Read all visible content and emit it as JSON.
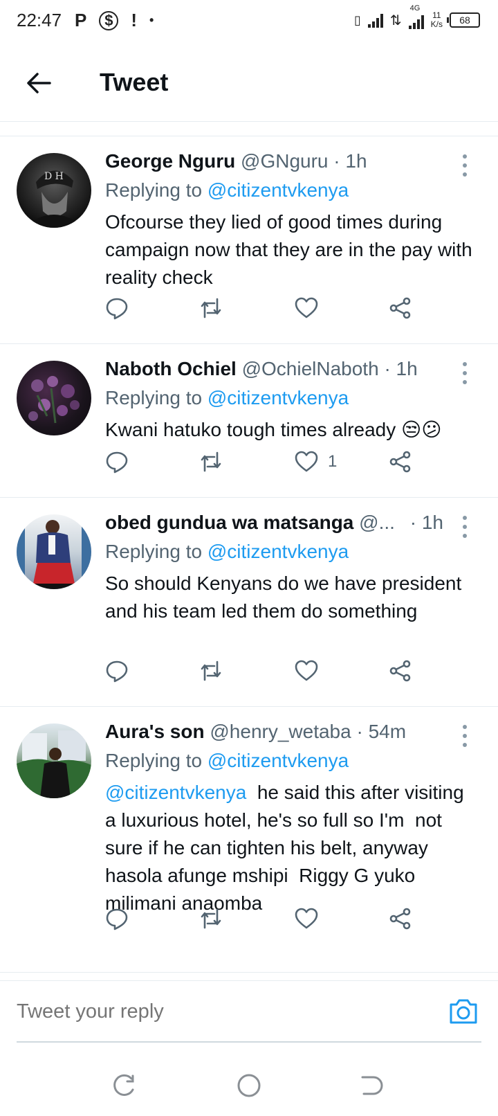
{
  "status_bar": {
    "time": "22:47",
    "left_icons": [
      "P",
      "$",
      "!",
      "•"
    ],
    "network": "4G",
    "speed_value": "11",
    "speed_unit": "K/s",
    "battery": "68"
  },
  "header": {
    "title": "Tweet"
  },
  "tweets": [
    {
      "name": "George Nguru",
      "handle": "@GNguru",
      "time": "1h",
      "replying_label": "Replying to",
      "replying_to": "@citizentvkenya",
      "text": "Ofcourse they lied of good times during campaign now that they are in the pay with reality check",
      "likes": ""
    },
    {
      "name": "Naboth Ochiel",
      "handle": "@OchielNaboth",
      "time": "1h",
      "replying_label": "Replying to",
      "replying_to": "@citizentvkenya",
      "text": "Kwani hatuko tough times already 😒😕",
      "likes": "1"
    },
    {
      "name": "obed gundua wa matsanga",
      "handle": "@...",
      "time": "1h",
      "replying_label": "Replying to",
      "replying_to": "@citizentvkenya",
      "text": "So should Kenyans do we have president and his team led them do something",
      "likes": ""
    },
    {
      "name": "Aura's son",
      "handle": "@henry_wetaba",
      "time": "54m",
      "replying_label": "Replying to",
      "replying_to": "@citizentvkenya",
      "text_mention": "@citizentvkenya",
      "text": "  he said this after visiting a luxurious hotel, he's so full so I'm  not sure if he can tighten his belt, anyway  hasola afunge mshipi  Riggy G yuko milimani anaomba",
      "likes": ""
    }
  ],
  "reply_bar": {
    "placeholder": "Tweet your reply"
  },
  "colors": {
    "accent": "#1d9bf0",
    "secondary_text": "#536471",
    "divider": "#e6ecf0"
  },
  "icons": [
    "arrow-left-icon",
    "more-vertical-icon",
    "reply-icon",
    "retweet-icon",
    "like-icon",
    "share-icon",
    "camera-icon",
    "nav-recents-icon",
    "nav-home-icon",
    "nav-back-icon"
  ]
}
